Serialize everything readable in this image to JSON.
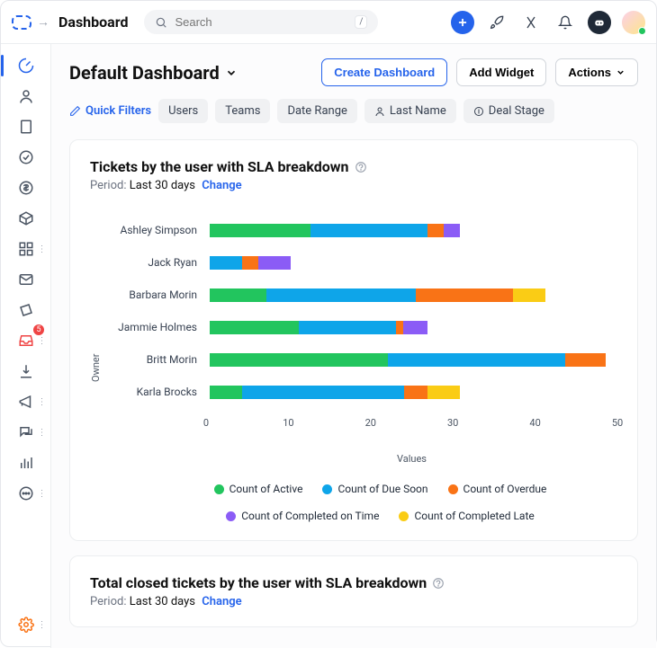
{
  "top": {
    "title": "Dashboard",
    "search_placeholder": "Search",
    "kbd": "/"
  },
  "sidebar": {
    "inbox_badge": "5"
  },
  "page": {
    "title": "Default Dashboard",
    "btn_create": "Create Dashboard",
    "btn_add_widget": "Add Widget",
    "btn_actions": "Actions"
  },
  "filters": {
    "quick": "Quick Filters",
    "f1": "Users",
    "f2": "Teams",
    "f3": "Date Range",
    "f4": "Last Name",
    "f5": "Deal Stage"
  },
  "card1": {
    "title": "Tickets by the user with SLA breakdown",
    "period_label": "Period:",
    "period_value": "Last 30 days",
    "change": "Change",
    "x_axis": "Values",
    "y_axis": "Owner"
  },
  "card2": {
    "title": "Total closed tickets by the user with SLA breakdown",
    "period_label": "Period:",
    "period_value": "Last 30 days",
    "change": "Change"
  },
  "legend": {
    "l1": "Count of Active",
    "l2": "Count of Due Soon",
    "l3": "Count of Overdue",
    "l4": "Count of Completed on Time",
    "l5": "Count of Completed Late"
  },
  "colors": {
    "active": "#22c55e",
    "due_soon": "#0ea5e9",
    "overdue": "#f97316",
    "on_time": "#8b5cf6",
    "late": "#facc15"
  },
  "chart_data": {
    "type": "bar",
    "orientation": "horizontal",
    "stacked": true,
    "xlabel": "Values",
    "ylabel": "Owner",
    "xlim": [
      0,
      50
    ],
    "ticks": [
      0,
      10,
      20,
      30,
      40,
      50
    ],
    "categories": [
      "Ashley Simpson",
      "Jack Ryan",
      "Barbara Morin",
      "Jammie Holmes",
      "Britt Morin",
      "Karla Brocks"
    ],
    "series": [
      {
        "name": "Count of Active",
        "color": "#22c55e",
        "values": [
          12.5,
          0,
          7,
          11,
          22,
          4
        ]
      },
      {
        "name": "Count of Due Soon",
        "color": "#0ea5e9",
        "values": [
          14.5,
          4,
          18.5,
          12,
          22,
          20
        ]
      },
      {
        "name": "Count of Overdue",
        "color": "#f97316",
        "values": [
          2,
          2,
          12,
          1,
          5,
          3
        ]
      },
      {
        "name": "Count of Completed on Time",
        "color": "#8b5cf6",
        "values": [
          2,
          4,
          0,
          3,
          0,
          0
        ]
      },
      {
        "name": "Count of Completed Late",
        "color": "#facc15",
        "values": [
          0,
          0,
          4,
          0,
          0,
          4
        ]
      }
    ]
  }
}
